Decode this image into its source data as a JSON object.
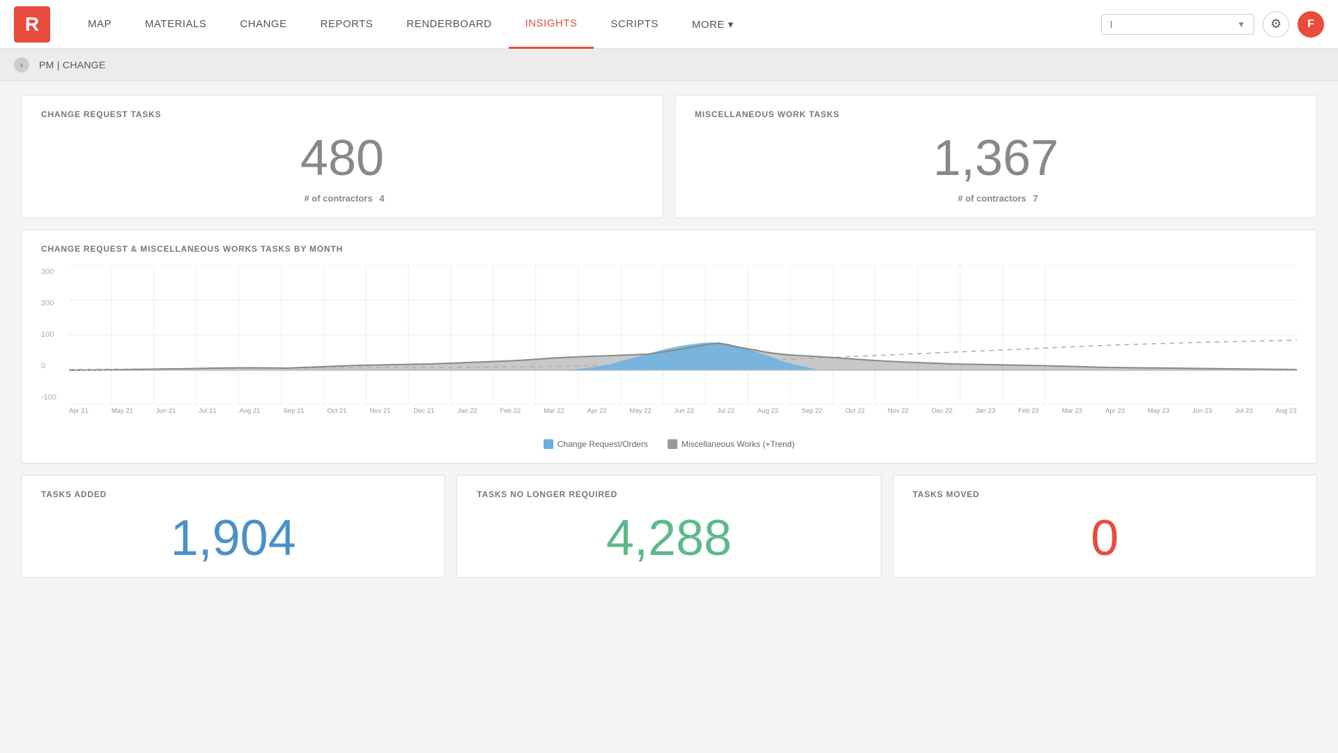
{
  "nav": {
    "logo_letter": "R",
    "items": [
      {
        "label": "MAP",
        "active": false
      },
      {
        "label": "MATERIALS",
        "active": false
      },
      {
        "label": "CHANGE",
        "active": false
      },
      {
        "label": "REPORTS",
        "active": false
      },
      {
        "label": "RENDERBOARD",
        "active": false
      },
      {
        "label": "INSIGHTS",
        "active": true
      },
      {
        "label": "SCRIPTS",
        "active": false
      },
      {
        "label": "MORE",
        "active": false,
        "has_arrow": true
      }
    ],
    "search_placeholder": "l",
    "gear_icon": "⚙",
    "avatar_letter": "F"
  },
  "breadcrumb": {
    "toggle_icon": "›",
    "text": "PM | CHANGE"
  },
  "change_request_tasks": {
    "title": "CHANGE REQUEST TASKS",
    "number": "480",
    "sub_label": "# of contractors",
    "sub_value": "4"
  },
  "misc_work_tasks": {
    "title": "MISCELLANEOUS WORK TASKS",
    "number": "1,367",
    "sub_label": "# of contractors",
    "sub_value": "7"
  },
  "chart": {
    "title": "CHANGE REQUEST & MISCELLANEOUS WORKS TASKS BY MONTH",
    "y_labels": [
      "300",
      "200",
      "100",
      "0",
      "-100"
    ],
    "x_labels": [
      "Apr 21",
      "May 21",
      "Jun 21",
      "Jul 21",
      "Aug 21",
      "Sep 21",
      "Oct 21",
      "Nov 21",
      "Dec 21",
      "Jan 22",
      "Feb 22",
      "Mar 22",
      "Apr 22",
      "May 22",
      "Jun 22",
      "Jul 22",
      "Aug 22",
      "Sep 22",
      "Oct 22",
      "Nov 22",
      "Dec 22",
      "Jan 23",
      "Feb 23",
      "Mar 23",
      "Apr 23",
      "May 23",
      "Jun 23",
      "Jul 23",
      "Aug 23"
    ],
    "legend": [
      {
        "label": "Change Request/Orders",
        "color": "blue"
      },
      {
        "label": "Miscellaneous Works (+Trend)",
        "color": "gray"
      }
    ]
  },
  "tasks_added": {
    "title": "TASKS ADDED",
    "number": "1,904",
    "color": "blue"
  },
  "tasks_no_longer": {
    "title": "TASKS NO LONGER REQUIRED",
    "number": "4,288",
    "color": "green"
  },
  "tasks_moved": {
    "title": "TASKS MOVED",
    "number": "0",
    "color": "red"
  }
}
